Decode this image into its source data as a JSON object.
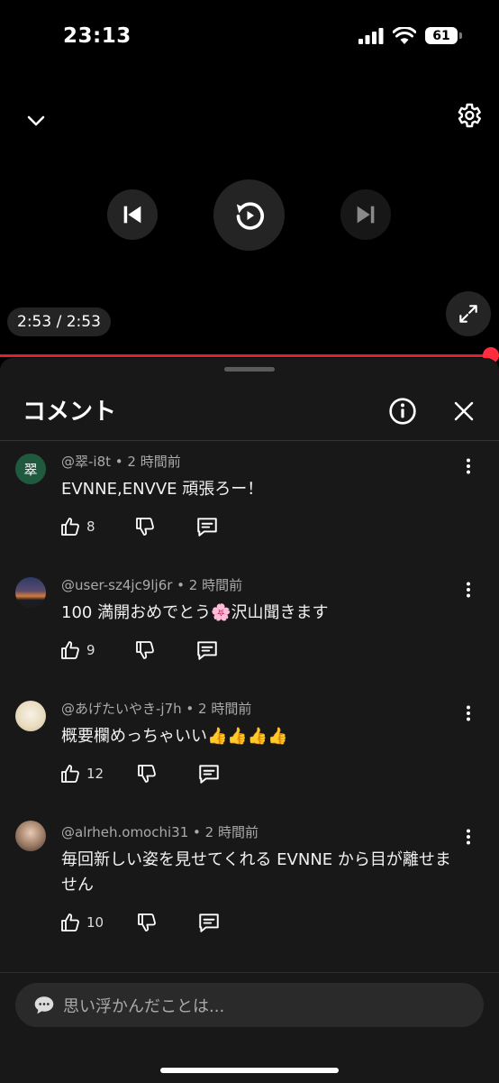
{
  "status": {
    "time": "23:13",
    "battery": "61"
  },
  "player": {
    "time": "2:53 / 2:53",
    "progress": 1.0
  },
  "sheet": {
    "title": "コメント"
  },
  "comments": [
    {
      "author": "@翠-i8t",
      "age": "2 時間前",
      "text": "EVNNE,ENVVE 頑張ろー！",
      "likes": "8",
      "avatar_text": "翠",
      "avatar_color": "#1f5a3e"
    },
    {
      "author": "@user-sz4jc9lj6r",
      "age": "2 時間前",
      "text": "100 満開おめでとう🌸沢山聞きます",
      "likes": "9",
      "avatar_text": "",
      "avatar_color": "#3b3a52"
    },
    {
      "author": "@あげたいやき-j7h",
      "age": "2 時間前",
      "text": "概要欄めっちゃいい👍👍👍👍",
      "likes": "12",
      "avatar_text": "",
      "avatar_color": "#e7ddc8"
    },
    {
      "author": "@alrheh.omochi31",
      "age": "2 時間前",
      "text": "毎回新しい姿を見せてくれる EVNNE から目が離せません",
      "likes": "10",
      "avatar_text": "",
      "avatar_color": "#6b5a4a"
    }
  ],
  "input": {
    "placeholder": "思い浮かんだことは..."
  },
  "icons": {
    "collapse": "chevron-down-icon",
    "settings": "gear-icon",
    "previous": "skip-previous-icon",
    "replay": "replay-icon",
    "next": "skip-next-icon",
    "fullscreen": "fullscreen-icon",
    "info": "info-icon",
    "close": "close-icon",
    "more": "more-vert-icon",
    "like": "thumb-up-icon",
    "dislike": "thumb-down-icon",
    "reply": "reply-icon",
    "emoji": "speech-bubble-icon"
  },
  "colors": {
    "accent": "#ff2d3d",
    "sheet": "#181818",
    "meta": "#aaaaaa"
  }
}
